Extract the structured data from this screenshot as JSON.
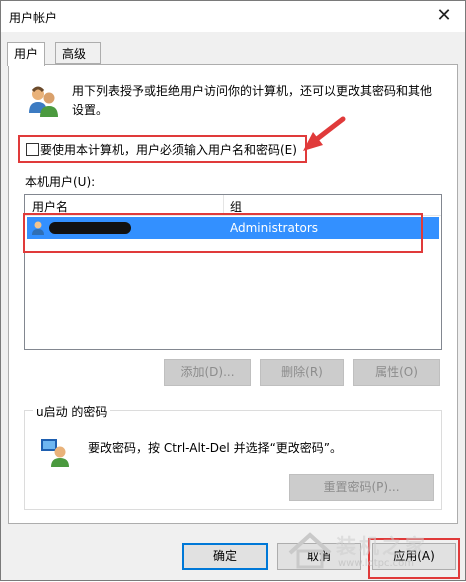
{
  "window": {
    "title": "用户帐户"
  },
  "tabs": [
    {
      "label": "用户",
      "active": true
    },
    {
      "label": "高级",
      "active": false
    }
  ],
  "intro_text": "用下列表授予或拒绝用户访问你的计算机，还可以更改其密码和其他设置。",
  "require_login": {
    "label": "要使用本计算机，用户必须输入用户名和密码(E)",
    "checked": false
  },
  "local_users": {
    "label": "本机用户(U):",
    "columns": [
      "用户名",
      "组"
    ],
    "rows": [
      {
        "username": "",
        "group": "Administrators",
        "selected": true
      }
    ]
  },
  "user_buttons": {
    "add": "添加(D)...",
    "remove": "删除(R)",
    "properties": "属性(O)"
  },
  "password_group": {
    "title": "u启动 的密码",
    "text": "要改密码，按 Ctrl-Alt-Del 并选择“更改密码”。",
    "reset_button": "重置密码(P)..."
  },
  "footer_buttons": {
    "ok": "确定",
    "cancel": "取消",
    "apply": "应用(A)"
  },
  "watermark": {
    "text": "装机之家",
    "url": "www.lotpc.com"
  },
  "colors": {
    "selection": "#3390ff",
    "annotation_red": "#e03a3a",
    "focus_blue": "#0078d7"
  }
}
